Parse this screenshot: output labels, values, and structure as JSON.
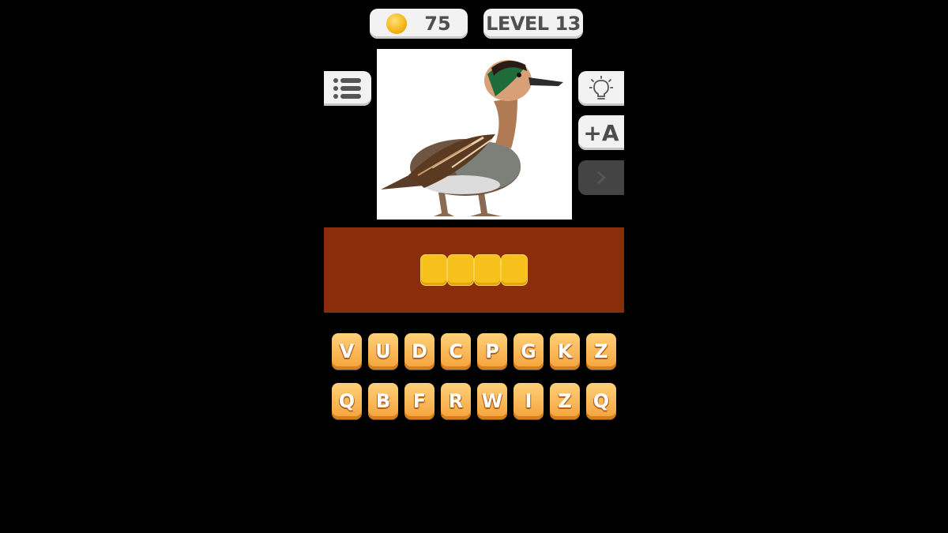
{
  "hud": {
    "coins": "75",
    "level": "LEVEL 13"
  },
  "puzzle": {
    "picture_subject": "duck",
    "answer_slots": [
      "",
      "",
      "",
      ""
    ]
  },
  "buttons": {
    "menu_icon": "list-icon",
    "hint_icon": "lightbulb-icon",
    "reveal_letter_label": "+A",
    "skip_icon": "arrow-right-icon"
  },
  "keyboard": {
    "row1": [
      "V",
      "U",
      "D",
      "C",
      "P",
      "G",
      "K",
      "Z"
    ],
    "row2": [
      "Q",
      "B",
      "F",
      "R",
      "W",
      "I",
      "Z",
      "Q"
    ]
  },
  "colors": {
    "background": "#000000",
    "answer_panel": "#8a2d0a",
    "slot": "#f7c11c",
    "key": "#f4a33a"
  }
}
